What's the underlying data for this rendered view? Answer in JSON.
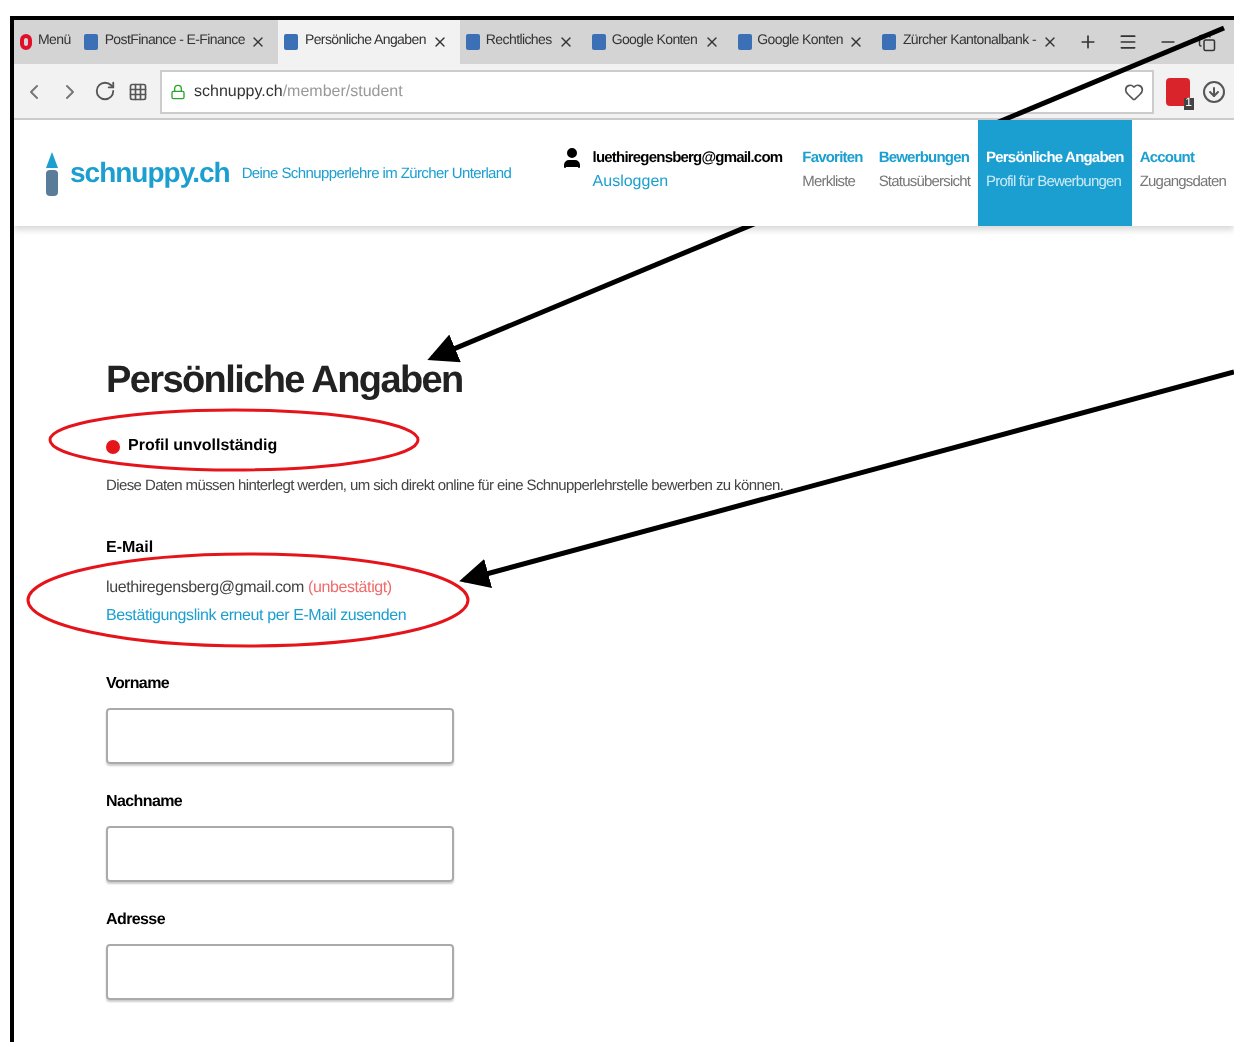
{
  "browser_tabs": [
    {
      "label": "Menü",
      "kind": "menu",
      "selected": false
    },
    {
      "label": "PostFinance - E-Finance",
      "kind": "page",
      "selected": false
    },
    {
      "label": "Persönliche Angaben",
      "kind": "page",
      "selected": true
    },
    {
      "label": "Rechtliches",
      "kind": "page",
      "selected": false
    },
    {
      "label": "Google Konten",
      "kind": "page",
      "selected": false
    },
    {
      "label": "Google Konten",
      "kind": "page",
      "selected": false
    },
    {
      "label": "Zürcher Kantonalbank -",
      "kind": "page",
      "selected": false
    }
  ],
  "address_bar": {
    "domain": "schnuppy.ch",
    "path": "/member/student"
  },
  "extension_badge": "1",
  "site_header": {
    "logo": "schnuppy.ch",
    "tagline": "Deine Schnupperlehre im Zürcher Unterland",
    "user_email": "luethiregensberg@gmail.com",
    "logout": "Ausloggen",
    "nav": [
      {
        "title": "Favoriten",
        "subtitle": "Merkliste",
        "selected": false
      },
      {
        "title": "Bewerbungen",
        "subtitle": "Statusübersicht",
        "selected": false
      },
      {
        "title": "Persönliche Angaben",
        "subtitle": "Profil für Bewerbungen",
        "selected": true
      },
      {
        "title": "Account",
        "subtitle": "Zugangsdaten",
        "selected": false
      }
    ]
  },
  "page": {
    "heading": "Persönliche Angaben",
    "profile_status": {
      "label": "Profil unvollständig",
      "complete": false
    },
    "description": "Diese Daten müssen hinterlegt werden, um sich direkt online für eine Schnupperlehrstelle bewerben zu können.",
    "email_section": {
      "label": "E-Mail",
      "value": "luethiregensberg@gmail.com",
      "confirmation": "(unbestätigt)",
      "confirmed": false,
      "resend_link": "Bestätigungslink erneut per E-Mail zusenden"
    },
    "fields": [
      {
        "label": "Vorname"
      },
      {
        "label": "Nachname"
      },
      {
        "label": "Adresse"
      }
    ]
  }
}
